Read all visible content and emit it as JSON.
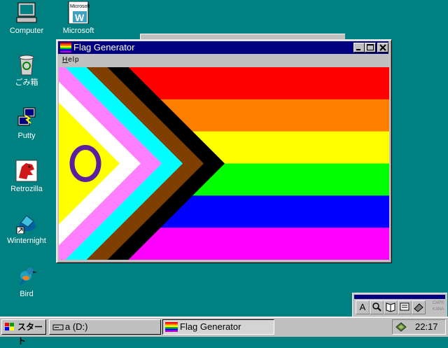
{
  "desktop": {
    "icons": [
      {
        "label": "Computer"
      },
      {
        "label": "Microsoft"
      },
      {
        "label": "ごみ箱"
      },
      {
        "label": "Putty"
      },
      {
        "label": "Retrozilla"
      },
      {
        "label": "Winternight"
      },
      {
        "label": "Bird"
      }
    ],
    "word_icon_text": "Microsoft"
  },
  "window": {
    "title": "Flag Generator",
    "menu": [
      {
        "label": "Help",
        "accel": "H",
        "rest": "elp"
      }
    ],
    "flag": {
      "stripes": [
        "#ff0000",
        "#ff8000",
        "#ffff00",
        "#00ff00",
        "#0000ff",
        "#ff00ff"
      ],
      "chevrons": [
        "#000000",
        "#7f3f00",
        "#00ffff",
        "#ff80ff",
        "#ffffff"
      ],
      "intersex_field": "#ffff00",
      "ring": "#5a1fa0"
    }
  },
  "taskbar": {
    "start_label": "スタート",
    "drive_label": "a (D:)",
    "active_task": "Flag Generator",
    "clock": "22:17"
  },
  "ime": {
    "buttons": [
      "A",
      "🔍",
      "📖",
      "📰",
      "◆"
    ],
    "caps": "CAPS",
    "kana": "KANA"
  }
}
